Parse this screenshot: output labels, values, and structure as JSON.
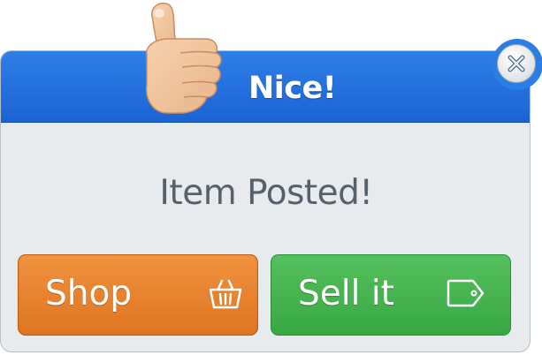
{
  "dialog": {
    "title": "Nice!",
    "message": "Item Posted!",
    "header_icon": "thumbs-up-icon",
    "close_icon": "close-icon"
  },
  "buttons": {
    "shop": {
      "label": "Shop",
      "icon": "basket-icon"
    },
    "sell": {
      "label": "Sell it",
      "icon": "price-tag-icon"
    }
  },
  "colors": {
    "header_blue": "#2f7fe8",
    "body_gray": "#e8ebee",
    "shop_orange": "#ee8a33",
    "sell_green": "#4ab653",
    "message_text": "#56616c"
  }
}
